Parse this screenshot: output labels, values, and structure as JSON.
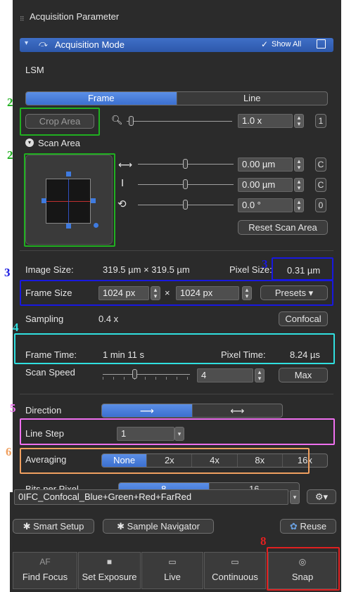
{
  "panel": {
    "title": "Acquisition Parameter",
    "mode_bar": {
      "title": "Acquisition Mode",
      "show_all": "Show All"
    },
    "lsm_label": "LSM",
    "scan_type_tabs": [
      {
        "label": "Frame",
        "selected": true
      },
      {
        "label": "Line",
        "selected": false
      }
    ],
    "crop_area_button": "Crop Area",
    "zoom": {
      "value": "1.0 x",
      "reset": "1"
    },
    "scan_area_label": "Scan Area",
    "offset_x": {
      "value": "0.00 µm",
      "reset": "C"
    },
    "offset_y": {
      "value": "0.00 µm",
      "reset": "C"
    },
    "rotation": {
      "value": "0.0 °",
      "reset": "0"
    },
    "reset_scan_area_button": "Reset Scan Area",
    "image_size": {
      "label": "Image Size:",
      "value": "319.5 µm × 319.5 µm"
    },
    "pixel_size": {
      "label": "Pixel Size:",
      "value": "0.31 µm"
    },
    "frame_size": {
      "label": "Frame Size",
      "width": "1024 px",
      "times": "×",
      "height": "1024 px",
      "presets": "Presets ▾"
    },
    "sampling": {
      "label": "Sampling",
      "value": "0.4 x",
      "button": "Confocal"
    },
    "frame_time": {
      "label": "Frame Time:",
      "value": "1 min 11 s"
    },
    "pixel_time": {
      "label": "Pixel Time:",
      "value": "8.24 µs"
    },
    "scan_speed": {
      "label": "Scan Speed",
      "value": "4",
      "max": "Max"
    },
    "direction": {
      "label": "Direction"
    },
    "line_step": {
      "label": "Line Step",
      "value": "1"
    },
    "averaging": {
      "label": "Averaging",
      "options": [
        "None",
        "2x",
        "4x",
        "8x",
        "16x"
      ],
      "selected": "None"
    },
    "bits_per_pixel": {
      "label": "Bits per Pixel",
      "options": [
        "8",
        "16"
      ]
    }
  },
  "config": {
    "selected": "0IFC_Confocal_Blue+Green+Red+FarRed",
    "smart_setup": "Smart Setup",
    "sample_navigator": "Sample Navigator",
    "reuse": "Reuse"
  },
  "actions": [
    {
      "icon": "AF",
      "label": "Find Focus"
    },
    {
      "icon": "camera",
      "label": "Set Exposure"
    },
    {
      "icon": "live",
      "label": "Live"
    },
    {
      "icon": "continuous",
      "label": "Continuous"
    },
    {
      "icon": "snap",
      "label": "Snap"
    }
  ],
  "annotations": {
    "crop": "2",
    "scan_area": "2",
    "pixel_size": "3",
    "frame_size": "3",
    "frame_time": "4",
    "direction": "5",
    "averaging": "6",
    "snap": "8"
  },
  "colors": {
    "accent": "#3f6fc7",
    "green": "#20b020",
    "blue": "#1818e0",
    "cyan": "#30e0e0",
    "magenta": "#f070f0",
    "orange": "#f0a060",
    "red": "#e02020"
  }
}
